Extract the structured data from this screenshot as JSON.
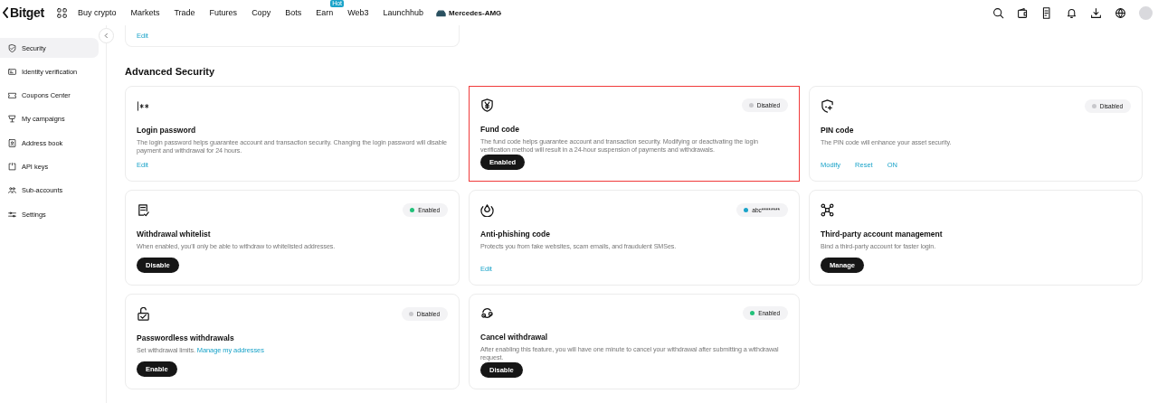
{
  "nav": {
    "logo": "Bitget",
    "items": [
      {
        "label": "Buy crypto"
      },
      {
        "label": "Markets"
      },
      {
        "label": "Trade"
      },
      {
        "label": "Futures"
      },
      {
        "label": "Copy"
      },
      {
        "label": "Bots"
      },
      {
        "label": "Earn",
        "badge": "Hot"
      },
      {
        "label": "Web3"
      },
      {
        "label": "Launchhub"
      }
    ],
    "promo": "Mercedes-AMG"
  },
  "sidebar": {
    "items": [
      {
        "label": "Security",
        "selected": true
      },
      {
        "label": "Identity verification",
        "selected": false
      },
      {
        "label": "Coupons Center",
        "selected": false
      },
      {
        "label": "My campaigns",
        "selected": false
      },
      {
        "label": "Address book",
        "selected": false
      },
      {
        "label": "API keys",
        "selected": false
      },
      {
        "label": "Sub-accounts",
        "selected": false
      },
      {
        "label": "Settings",
        "selected": false
      }
    ]
  },
  "top_card": {
    "action": "Edit"
  },
  "section_title": "Advanced Security",
  "cards": [
    {
      "title": "Login password",
      "description": "The login password helps guarantee account and transaction security. Changing the login password will disable payment and withdrawal for 24 hours.",
      "actions": [
        {
          "label": "Edit",
          "kind": "link"
        }
      ],
      "highlighted": false
    },
    {
      "title": "Fund code",
      "status": {
        "label": "Disabled",
        "color": "#c8c8cc"
      },
      "description": "The fund code helps guarantee account and transaction security. Modifying or deactivating the login verification method will result in a 24-hour suspension of payments and withdrawals.",
      "actions": [
        {
          "label": "Enabled",
          "kind": "button"
        }
      ],
      "highlighted": true
    },
    {
      "title": "PIN code",
      "status": {
        "label": "Disabled",
        "color": "#c8c8cc"
      },
      "description": "The PIN code will enhance your asset security.",
      "actions": [
        {
          "label": "Modify",
          "kind": "link"
        },
        {
          "label": "Reset",
          "kind": "link"
        },
        {
          "label": "ON",
          "kind": "link"
        }
      ],
      "highlighted": false
    },
    {
      "title": "Withdrawal whitelist",
      "status": {
        "label": "Enabled",
        "color": "#22c17a"
      },
      "description": "When enabled, you'll only be able to withdraw to whitelisted addresses.",
      "actions": [
        {
          "label": "Disable",
          "kind": "button"
        }
      ],
      "highlighted": false
    },
    {
      "title": "Anti-phishing code",
      "status": {
        "label": "abc********",
        "color": "#1aa3c9"
      },
      "description": "Protects you from fake websites, scam emails, and fraudulent SMSes.",
      "actions": [
        {
          "label": "Edit",
          "kind": "link"
        }
      ],
      "highlighted": false
    },
    {
      "title": "Third-party account management",
      "description": "Bind a third-party account for faster login.",
      "actions": [
        {
          "label": "Manage",
          "kind": "button"
        }
      ],
      "highlighted": false
    },
    {
      "title": "Passwordless withdrawals",
      "status": {
        "label": "Disabled",
        "color": "#c8c8cc"
      },
      "description": "Set withdrawal limits.",
      "link": "Manage my addresses",
      "actions": [
        {
          "label": "Enable",
          "kind": "button"
        }
      ],
      "highlighted": false
    },
    {
      "title": "Cancel withdrawal",
      "status": {
        "label": "Enabled",
        "color": "#22c17a"
      },
      "description": "After enabling this feature, you will have one minute to cancel your withdrawal after submitting a withdrawal request.",
      "actions": [
        {
          "label": "Disable",
          "kind": "button"
        }
      ],
      "highlighted": false
    }
  ]
}
